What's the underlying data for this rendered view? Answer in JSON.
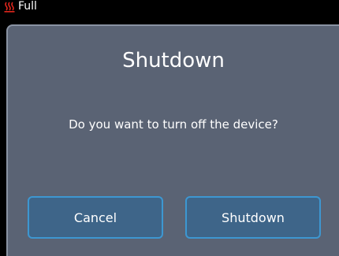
{
  "status_bar": {
    "icon": "heater-icon",
    "icon_color": "#e0261c",
    "text": "Full"
  },
  "dialog": {
    "title": "Shutdown",
    "message": "Do you want to turn off the device?",
    "cancel_label": "Cancel",
    "confirm_label": "Shutdown",
    "background": "#5a6374",
    "button_color": "#3e6589",
    "button_border": "#3d97d1"
  }
}
